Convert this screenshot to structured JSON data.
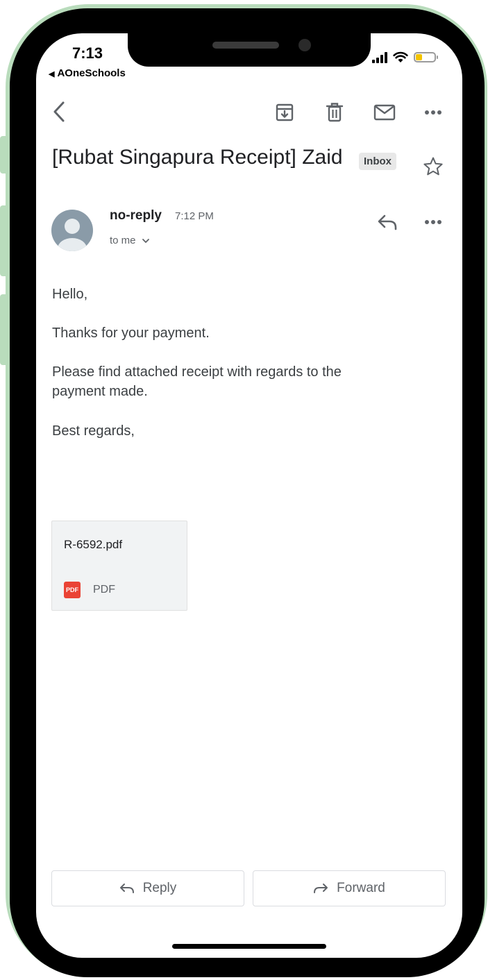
{
  "status_bar": {
    "time": "7:13",
    "back_app": "AOneSchools"
  },
  "toolbar": {
    "back_icon": "chevron-left-icon",
    "archive_icon": "archive-icon",
    "delete_icon": "trash-icon",
    "mark_unread_icon": "mail-icon",
    "more_icon": "more-horizontal-icon"
  },
  "email": {
    "subject": "[Rubat Singapura Receipt] Zaid",
    "label": "Inbox",
    "sender": "no-reply",
    "time": "7:12 PM",
    "recipient": "to me",
    "body": {
      "greeting": "Hello,",
      "line1": "Thanks for your payment.",
      "line2": "Please find attached receipt with regards to the",
      "line3": "payment made.",
      "closing": "Best regards,"
    },
    "attachment": {
      "filename": "R-6592.pdf",
      "badge": "PDF",
      "type": "PDF"
    }
  },
  "actions": {
    "reply_label": "Reply",
    "forward_label": "Forward"
  },
  "colors": {
    "frame_accent": "#b9dcbc",
    "pdf_red": "#ea4335",
    "battery": "#f3c400"
  }
}
